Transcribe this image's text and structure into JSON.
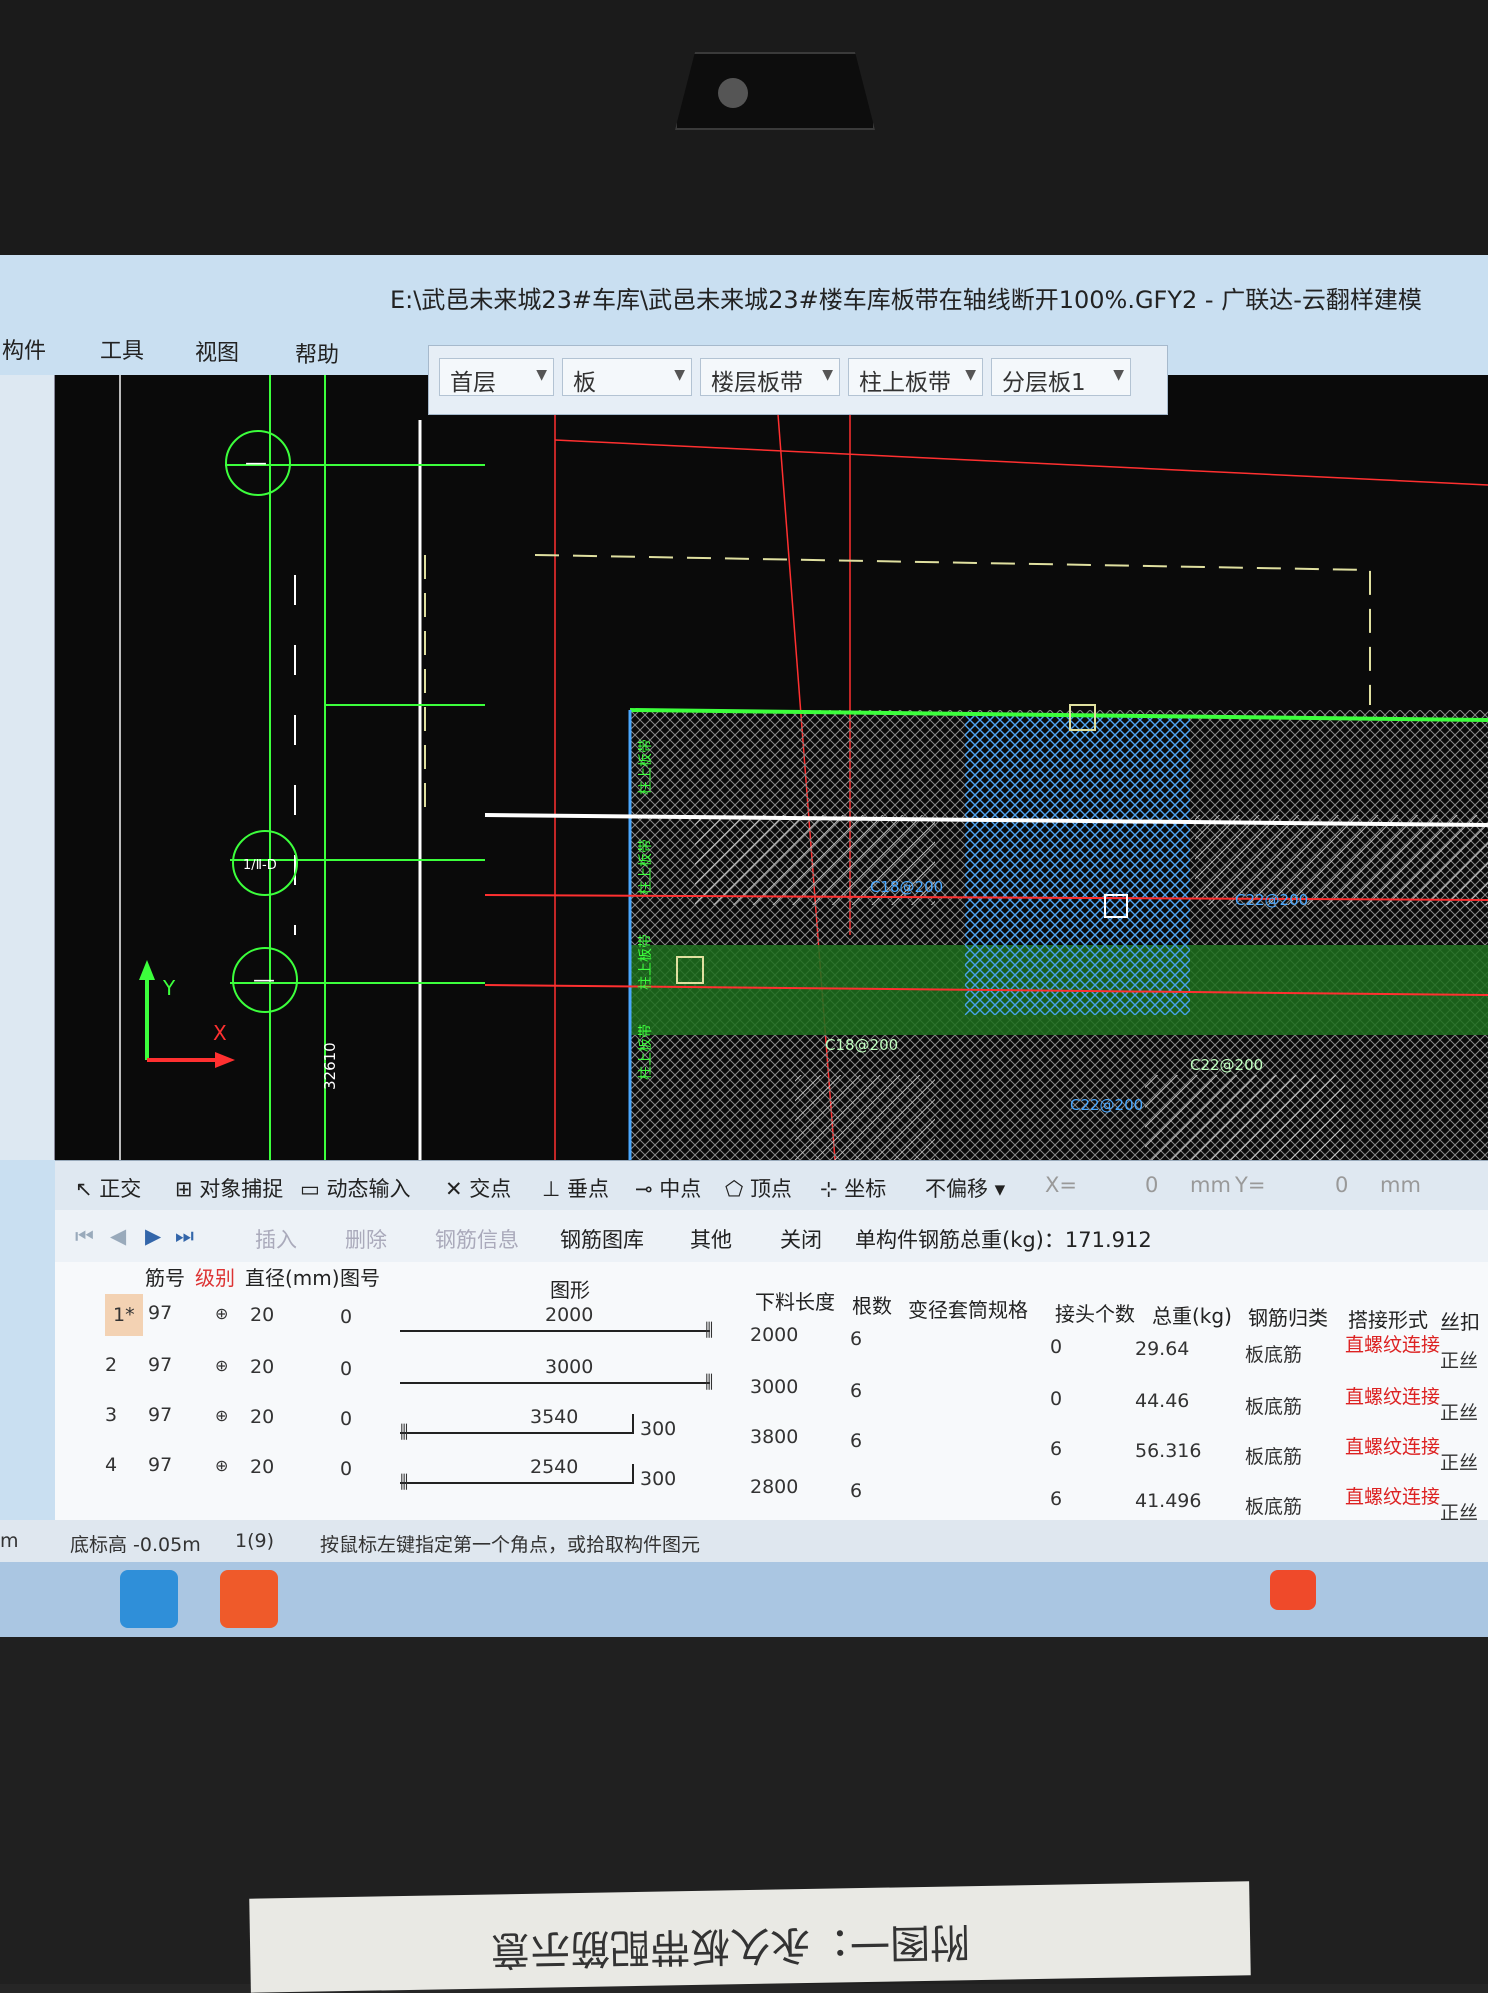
{
  "window": {
    "title": "E:\\武邑未来城23#车库\\武邑未来城23#楼车库板带在轴线断开100%.GFY2 - 广联达-云翻样建模"
  },
  "menu": {
    "items": [
      "构件",
      "工具",
      "视图",
      "帮助"
    ]
  },
  "selectors": [
    {
      "value": "首层"
    },
    {
      "value": "板"
    },
    {
      "value": "楼层板带"
    },
    {
      "value": "柱上板带"
    },
    {
      "value": "分层板1"
    }
  ],
  "cad": {
    "axis_labels": {
      "a": "—",
      "b": "1/Ⅱ-D",
      "c": "—"
    },
    "dimension": "32610",
    "ucs_x": "X",
    "ucs_y": "Y",
    "rebar_labels": [
      "C18@200",
      "C22@200",
      "C18@200",
      "C22@200",
      "C22@200"
    ],
    "strip_labels": [
      "柱上板带",
      "柱上板带",
      "柱上板带",
      "柱上板带"
    ],
    "colors": {
      "grid": "#3cff3c",
      "white": "#ffffff",
      "red": "#ff3030",
      "blue_hatch": "#4aa8ff",
      "green_fill": "#1d6e1d",
      "hatch": "#cfcfcf"
    }
  },
  "snap": {
    "items": [
      "正交",
      "对象捕捉",
      "动态输入",
      "交点",
      "垂点",
      "中点",
      "顶点",
      "坐标"
    ],
    "offset": "不偏移",
    "x_label": "X=",
    "x_value": "0",
    "x_unit": "mm",
    "y_label": "Y=",
    "y_value": "0",
    "y_unit": "mm"
  },
  "table_toolbar": {
    "insert": "插入",
    "delete": "删除",
    "rebar_info": "钢筋信息",
    "rebar_lib": "钢筋图库",
    "other": "其他",
    "close": "关闭",
    "total_weight": "单构件钢筋总重(kg)：171.912"
  },
  "table": {
    "headers": [
      "筋号",
      "级别",
      "直径(mm)",
      "图号",
      "图形",
      "下料长度",
      "根数",
      "变径套筒规格",
      "接头个数",
      "总重(kg)",
      "钢筋归类",
      "搭接形式",
      "丝扣"
    ],
    "rows": [
      {
        "idx": "1*",
        "jh": "97",
        "grade": "⊕",
        "dia": "20",
        "tuhao": "0",
        "fig_len": "2000",
        "fig_hook": "",
        "cut": "2000",
        "count": "6",
        "joints": "0",
        "weight": "29.64",
        "cat": "板底筋",
        "lap": "直螺纹连接",
        "thread": "正丝"
      },
      {
        "idx": "2",
        "jh": "97",
        "grade": "⊕",
        "dia": "20",
        "tuhao": "0",
        "fig_len": "3000",
        "fig_hook": "",
        "cut": "3000",
        "count": "6",
        "joints": "0",
        "weight": "44.46",
        "cat": "板底筋",
        "lap": "直螺纹连接",
        "thread": "正丝"
      },
      {
        "idx": "3",
        "jh": "97",
        "grade": "⊕",
        "dia": "20",
        "tuhao": "0",
        "fig_len": "3540",
        "fig_hook": "300",
        "cut": "3800",
        "count": "6",
        "joints": "6",
        "weight": "56.316",
        "cat": "板底筋",
        "lap": "直螺纹连接",
        "thread": "正丝"
      },
      {
        "idx": "4",
        "jh": "97",
        "grade": "⊕",
        "dia": "20",
        "tuhao": "0",
        "fig_len": "2540",
        "fig_hook": "300",
        "cut": "2800",
        "count": "6",
        "joints": "6",
        "weight": "41.496",
        "cat": "板底筋",
        "lap": "直螺纹连接",
        "thread": "正丝"
      }
    ]
  },
  "status": {
    "left": "m",
    "elev": "底标高 -0.05m",
    "count": "1(9)",
    "hint": "按鼠标左键指定第一个角点，或拾取构件图元"
  },
  "paper": {
    "text": "附图一：永久板带配筋示意"
  }
}
